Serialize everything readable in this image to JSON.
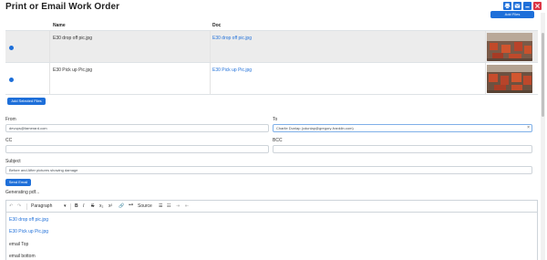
{
  "window": {
    "title": "Print or Email Work Order"
  },
  "header_buttons": [
    {
      "name": "print-icon",
      "color": "#1e6fd9"
    },
    {
      "name": "email-icon",
      "color": "#1e6fd9"
    },
    {
      "name": "minimize-icon",
      "color": "#1e6fd9"
    },
    {
      "name": "close-icon",
      "color": "#dc3545"
    }
  ],
  "files": {
    "add_file_label": "Add Files",
    "columns": {
      "name": "Name",
      "doc": "Doc"
    },
    "rows": [
      {
        "name": "E30 drop off pic.jpg",
        "doc": "E30 drop off pic.jpg",
        "selected": true
      },
      {
        "name": "E30 Pick up Pic.jpg",
        "doc": "E30 Pick up Pic.jpg",
        "selected": false
      }
    ],
    "add_selected_label": "Add Selected Files"
  },
  "email": {
    "from_label": "From",
    "from_value": "devops@famerard.com",
    "to_label": "To",
    "to_value": "Charlie Dunlap (cdunlap@gregory-franklin.com)",
    "to_clear": "×",
    "cc_label": "CC",
    "cc_value": "",
    "bcc_label": "BCC",
    "bcc_value": "",
    "subject_label": "Subject",
    "subject_value": "Before and After pictures showing damage",
    "send_label": "Send Email"
  },
  "status": {
    "generating": "Generating pdf..."
  },
  "editor": {
    "toolbar": {
      "undo": "↶",
      "redo": "↷",
      "paragraph": "Paragraph",
      "paragraph_caret": "▾",
      "bold": "B",
      "italic": "I",
      "strikethrough": "S",
      "subscript": "x₂",
      "superscript": "x²",
      "link": "🔗",
      "quote": "❝❞",
      "source": "Source",
      "bullets": "☰",
      "numbered": "☷",
      "indent": "⇥",
      "outdent": "⇤"
    },
    "lines": [
      {
        "text": "E30 drop off pic.jpg",
        "type": "link"
      },
      {
        "text": "E30 Pick up Pic.jpg",
        "type": "link"
      },
      {
        "text": "email Top",
        "type": "plain"
      },
      {
        "text": "email bottom",
        "type": "plain"
      }
    ]
  },
  "colors": {
    "accent": "#1e6fd9",
    "danger": "#dc3545",
    "selected_row": "#ececec"
  }
}
